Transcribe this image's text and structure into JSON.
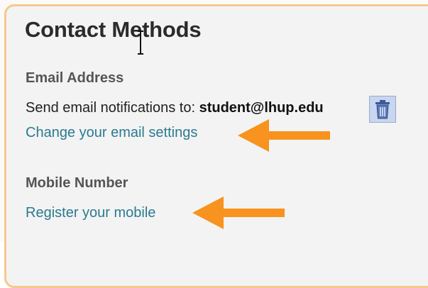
{
  "title": "Contact Methods",
  "email": {
    "heading": "Email Address",
    "notify_label": "Send email notifications to:",
    "address": "student@lhup.edu",
    "change_link": "Change your email settings",
    "delete_icon": "trash-icon"
  },
  "mobile": {
    "heading": "Mobile Number",
    "register_link": "Register your mobile"
  },
  "annotation": {
    "arrow_icon": "arrow-left-icon",
    "arrow_color": "#f7931e"
  },
  "colors": {
    "link": "#2a7a91",
    "border": "#f5c890"
  }
}
